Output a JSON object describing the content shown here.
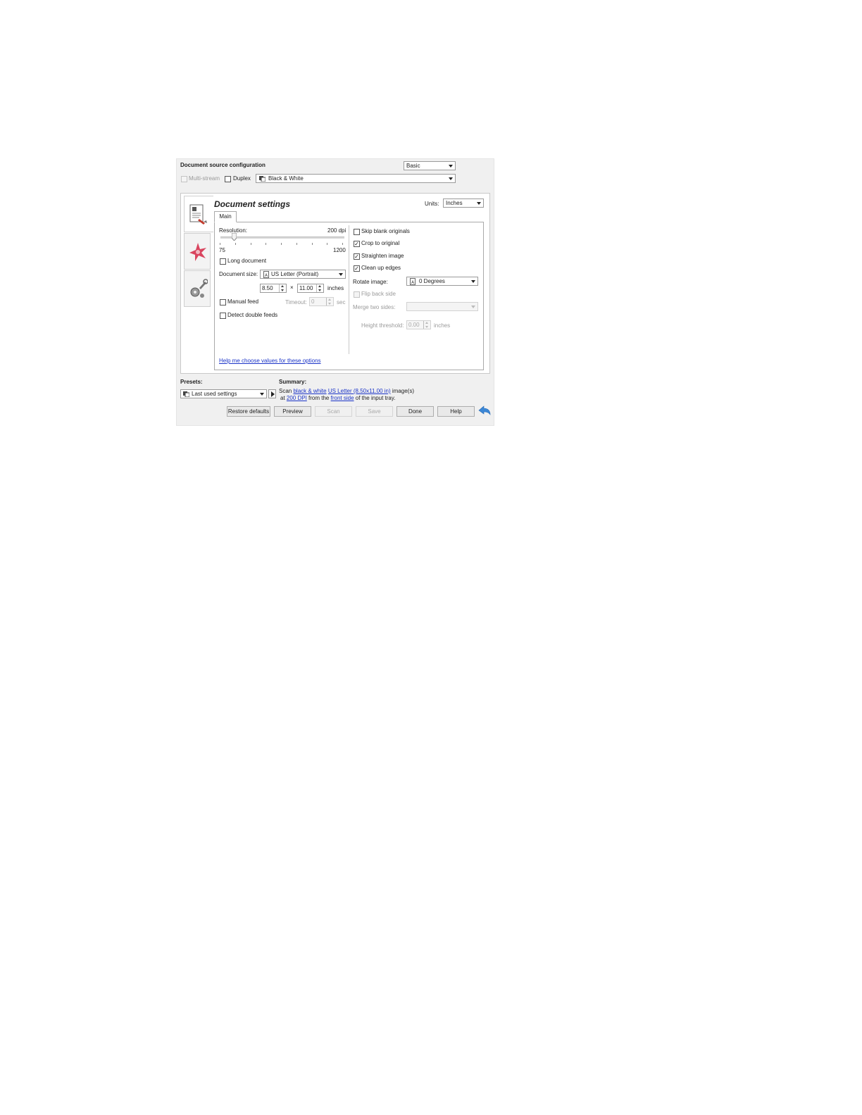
{
  "source": {
    "title": "Document source configuration",
    "mode_value": "Basic",
    "multistream_label": "Multi-stream",
    "duplex_label": "Duplex",
    "color_value": "Black & White"
  },
  "settings": {
    "title": "Document settings",
    "units_label": "Units:",
    "units_value": "Inches",
    "tab_main": "Main"
  },
  "left": {
    "resolution_label": "Resolution:",
    "resolution_value": "200 dpi",
    "slider_min": "75",
    "slider_max": "1200",
    "slider_fraction": 0.11,
    "long_document_label": "Long document",
    "doc_size_label": "Document size:",
    "doc_size_value": "US Letter (Portrait)",
    "width_value": "8.50",
    "times": "×",
    "height_value": "11.00",
    "size_units": "inches",
    "manual_feed_label": "Manual feed",
    "timeout_label": "Timeout:",
    "timeout_value": "0",
    "timeout_units": "sec",
    "detect_double_label": "Detect double feeds"
  },
  "right": {
    "skip_blank_label": "Skip blank originals",
    "crop_label": "Crop to original",
    "straighten_label": "Straighten image",
    "cleanup_label": "Clean up edges",
    "rotate_label": "Rotate image:",
    "rotate_value": "0 Degrees",
    "flip_back_label": "Flip back side",
    "merge_label": "Merge two sides:",
    "height_threshold_label": "Height threshold:",
    "height_threshold_value": "0.00",
    "height_threshold_units": "inches"
  },
  "help_link": "Help me choose values for these options",
  "presets": {
    "label": "Presets:",
    "value": "Last used settings"
  },
  "summary": {
    "label": "Summary:",
    "t1": "Scan ",
    "l1": "black & white",
    "t2": " ",
    "l2": "US Letter (8.50x11.00 in)",
    "t3": " image(s)",
    "t4": "at ",
    "l3": "200 DPI",
    "t5": " from the ",
    "l4": "front side",
    "t6": " of the input tray."
  },
  "buttons": {
    "restore": "Restore defaults",
    "preview": "Preview",
    "scan": "Scan",
    "save": "Save",
    "done": "Done",
    "help": "Help"
  },
  "colors": {
    "link": "#1a33c7",
    "back_arrow": "#3b87d6"
  }
}
